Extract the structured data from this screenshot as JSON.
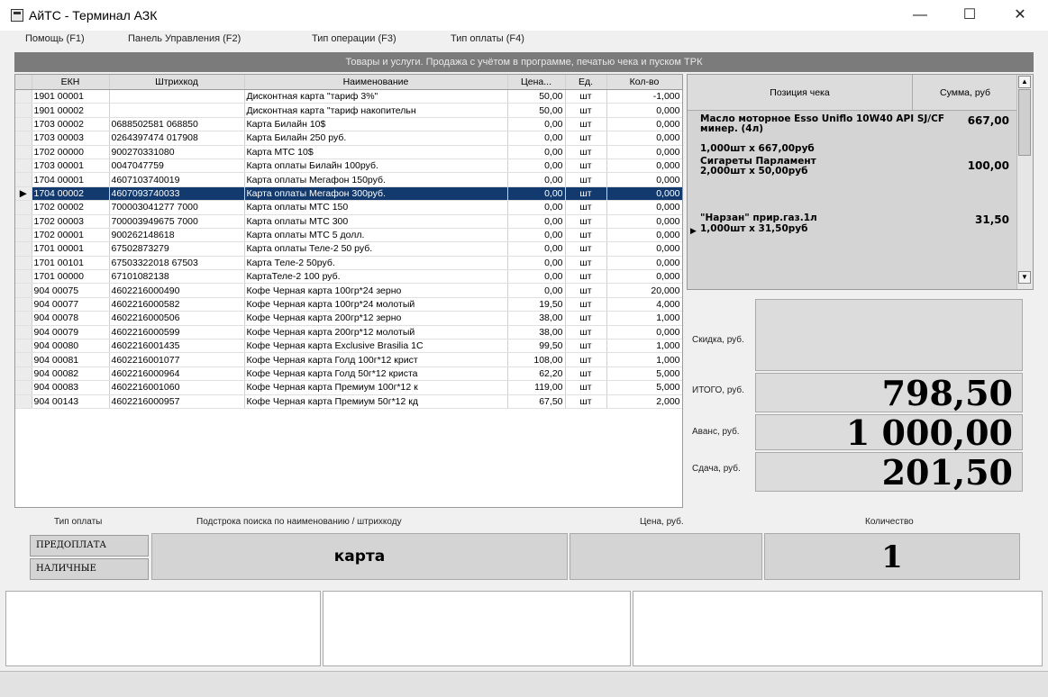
{
  "window": {
    "title": "АйТС - Терминал АЗК",
    "minimize": "—",
    "maximize": "☐",
    "close": "✕"
  },
  "menu": [
    "Помощь (F1)",
    "Панель Управления (F2)",
    "Тип операции (F3)",
    "Тип оплаты (F4)"
  ],
  "banner": "Товары и услуги. Продажа с учётом в программе, печатью чека и пуском ТРК",
  "grid": {
    "headers": [
      "ЕКН",
      "Штрихкод",
      "Наименование",
      "Цена...",
      "Ед.",
      "Кол-во"
    ],
    "selected_index": 7,
    "rows": [
      [
        "1901 00001",
        "",
        "Дисконтная карта \"тариф 3%\"",
        "50,00",
        "шт",
        "-1,000"
      ],
      [
        "1901 00002",
        "",
        "Дисконтная карта \"тариф накопительн",
        "50,00",
        "шт",
        "0,000"
      ],
      [
        "1703 00002",
        "0688502581 068850",
        "Карта Билайн 10$",
        "0,00",
        "шт",
        "0,000"
      ],
      [
        "1703 00003",
        "0264397474 017908",
        "Карта Билайн 250 руб.",
        "0,00",
        "шт",
        "0,000"
      ],
      [
        "1702 00000",
        "900270331080",
        "Карта МТС 10$",
        "0,00",
        "шт",
        "0,000"
      ],
      [
        "1703 00001",
        "0047047759",
        "Карта оплаты Билайн 100руб.",
        "0,00",
        "шт",
        "0,000"
      ],
      [
        "1704 00001",
        "4607103740019",
        "Карта оплаты Мегафон 150руб.",
        "0,00",
        "шт",
        "0,000"
      ],
      [
        "1704 00002",
        "4607093740033",
        "Карта оплаты Мегафон 300руб.",
        "0,00",
        "шт",
        "0,000"
      ],
      [
        "1702 00002",
        "700003041277 7000",
        "Карта оплаты МТС 150",
        "0,00",
        "шт",
        "0,000"
      ],
      [
        "1702 00003",
        "700003949675 7000",
        "Карта оплаты МТС 300",
        "0,00",
        "шт",
        "0,000"
      ],
      [
        "1702 00001",
        "900262148618",
        "Карта оплаты МТС 5 долл.",
        "0,00",
        "шт",
        "0,000"
      ],
      [
        "1701 00001",
        "67502873279",
        "Карта оплаты Теле-2  50 руб.",
        "0,00",
        "шт",
        "0,000"
      ],
      [
        "1701 00101",
        "67503322018 67503",
        "Карта Теле-2  50руб.",
        "0,00",
        "шт",
        "0,000"
      ],
      [
        "1701 00000",
        "67101082138",
        "КартаТеле-2 100 руб.",
        "0,00",
        "шт",
        "0,000"
      ],
      [
        "904 00075",
        "4602216000490",
        "Кофе Черная карта  100гр*24 зерно",
        "0,00",
        "шт",
        "20,000"
      ],
      [
        "904 00077",
        "4602216000582",
        "Кофе Черная карта  100гр*24 молотый",
        "19,50",
        "шт",
        "4,000"
      ],
      [
        "904 00078",
        "4602216000506",
        "Кофе Черная карта  200гр*12 зерно",
        "38,00",
        "шт",
        "1,000"
      ],
      [
        "904 00079",
        "4602216000599",
        "Кофе Черная карта  200гр*12 молотый",
        "38,00",
        "шт",
        "0,000"
      ],
      [
        "904 00080",
        "4602216001435",
        "Кофе Черная карта Exclusive Brasilia 1C",
        "99,50",
        "шт",
        "1,000"
      ],
      [
        "904 00081",
        "4602216001077",
        "Кофе Черная карта Голд 100г*12 крист",
        "108,00",
        "шт",
        "1,000"
      ],
      [
        "904 00082",
        "4602216000964",
        "Кофе Черная карта Голд 50г*12 криста",
        "62,20",
        "шт",
        "5,000"
      ],
      [
        "904 00083",
        "4602216001060",
        "Кофе Черная карта Премиум 100г*12 к",
        "119,00",
        "шт",
        "5,000"
      ],
      [
        "904 00143",
        "4602216000957",
        "Кофе Черная карта Премиум 50г*12 кд",
        "67,50",
        "шт",
        "2,000"
      ]
    ]
  },
  "receipt": {
    "col_position": "Позиция чека",
    "col_sum": "Сумма, руб",
    "items": [
      {
        "name": "Масло моторное Esso Uniflo 10W40 API SJ/CF минер. (4л)",
        "qty": "1,000шт x 667,00руб",
        "sum": "667,00"
      },
      {
        "name": "Сигареты Парламент",
        "qty": "2,000шт x 50,00руб",
        "sum": "100,00"
      },
      {
        "name": "\"Нарзан\" прир.газ.1л",
        "qty": "1,000шт x 31,50руб",
        "sum": "31,50"
      }
    ]
  },
  "totals": {
    "discount_label": "Скидка, руб.",
    "discount_value": "",
    "total_label": "ИТОГО, руб.",
    "total_value": "798,50",
    "advance_label": "Аванс, руб.",
    "advance_value": "1 000,00",
    "change_label": "Сдача, руб.",
    "change_value": "201,50"
  },
  "bottom": {
    "pay_type_label": "Тип оплаты",
    "search_label": "Подстрока поиска по наименованию / штрихкоду",
    "price_label": "Цена, руб.",
    "qty_label": "Количество",
    "prepay_button": "ПРЕДОПЛАТА",
    "cash_button": "НАЛИЧНЫЕ",
    "search_value": "карта",
    "price_value": "",
    "qty_value": "1"
  },
  "colors": {
    "selection": "#123a6e",
    "banner": "#7b7b7b"
  }
}
